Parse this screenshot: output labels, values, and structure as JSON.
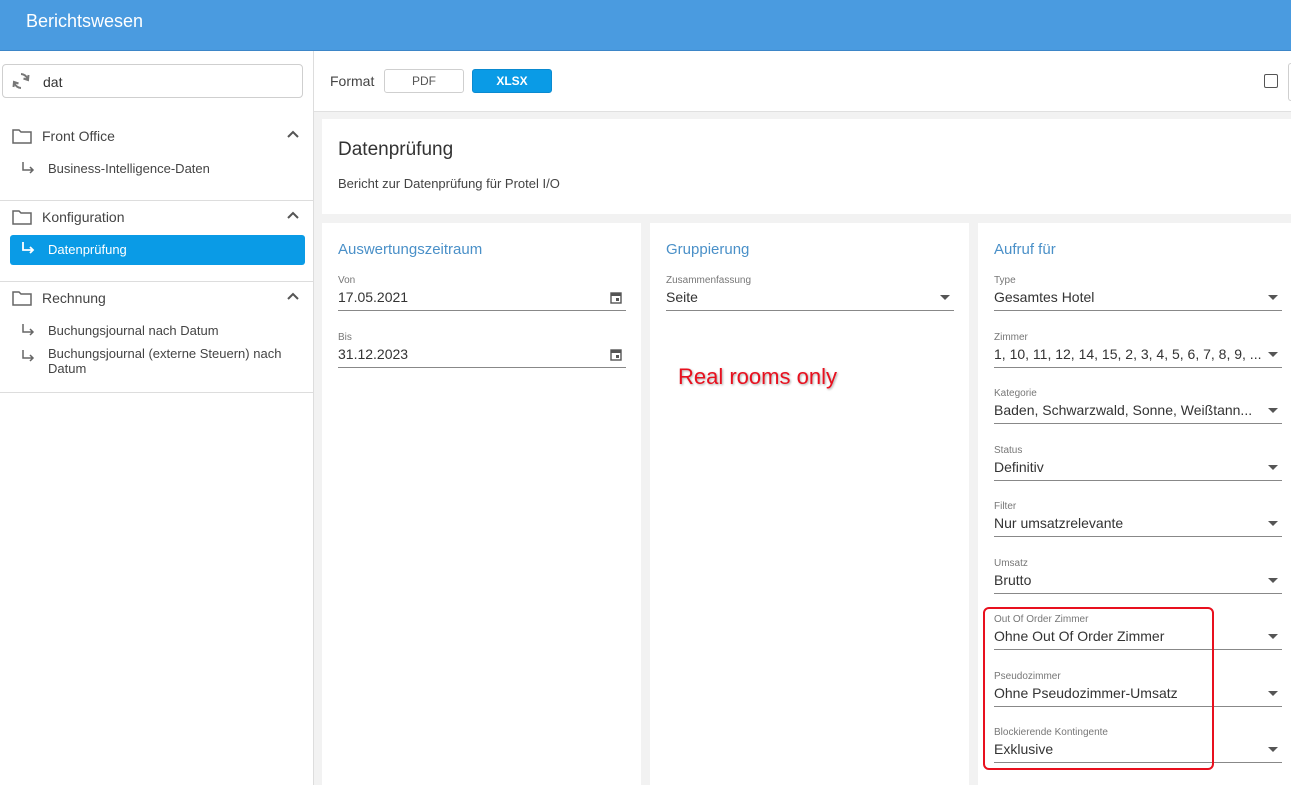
{
  "app": {
    "title": "Berichtswesen"
  },
  "sidebar": {
    "search_value": "dat",
    "groups": [
      {
        "label": "Front Office",
        "items": [
          {
            "label": "Business-Intelligence-Daten"
          }
        ]
      },
      {
        "label": "Konfiguration",
        "items": [
          {
            "label": "Datenprüfung",
            "active": true
          }
        ]
      },
      {
        "label": "Rechnung",
        "items": [
          {
            "label": "Buchungsjournal nach Datum"
          },
          {
            "label": "Buchungsjournal (externe Steuern) nach Datum"
          }
        ]
      }
    ]
  },
  "format": {
    "label": "Format",
    "options": [
      "PDF",
      "XLSX"
    ],
    "selected": "XLSX",
    "checkbox_checked": false
  },
  "report": {
    "title": "Datenprüfung",
    "description": "Bericht zur Datenprüfung für Protel I/O"
  },
  "panels": {
    "period": {
      "title": "Auswertungszeitraum",
      "fields": [
        {
          "label": "Von",
          "value": "17.05.2021"
        },
        {
          "label": "Bis",
          "value": "31.12.2023"
        }
      ]
    },
    "grouping": {
      "title": "Gruppierung",
      "fields": [
        {
          "label": "Zusammenfassung",
          "value": "Seite"
        }
      ]
    },
    "call": {
      "title": "Aufruf für",
      "fields": [
        {
          "label": "Type",
          "value": "Gesamtes Hotel"
        },
        {
          "label": "Zimmer",
          "value": "1, 10, 11, 12, 14, 15, 2, 3, 4, 5, 6, 7, 8, 9, ..."
        },
        {
          "label": "Kategorie",
          "value": "Baden, Schwarzwald, Sonne, Weißtann..."
        },
        {
          "label": "Status",
          "value": "Definitiv"
        },
        {
          "label": "Filter",
          "value": "Nur umsatzrelevante"
        },
        {
          "label": "Umsatz",
          "value": "Brutto"
        },
        {
          "label": "Out Of Order Zimmer",
          "value": "Ohne Out Of Order Zimmer"
        },
        {
          "label": "Pseudozimmer",
          "value": "Ohne Pseudozimmer-Umsatz"
        },
        {
          "label": "Blockierende Kontingente",
          "value": "Exklusive"
        }
      ]
    }
  },
  "annotation": {
    "text": "Real rooms only",
    "color": "#e8101e"
  },
  "colors": {
    "header": "#4a9be0",
    "accent": "#0a9be6",
    "panel_title": "#4a90c8"
  }
}
